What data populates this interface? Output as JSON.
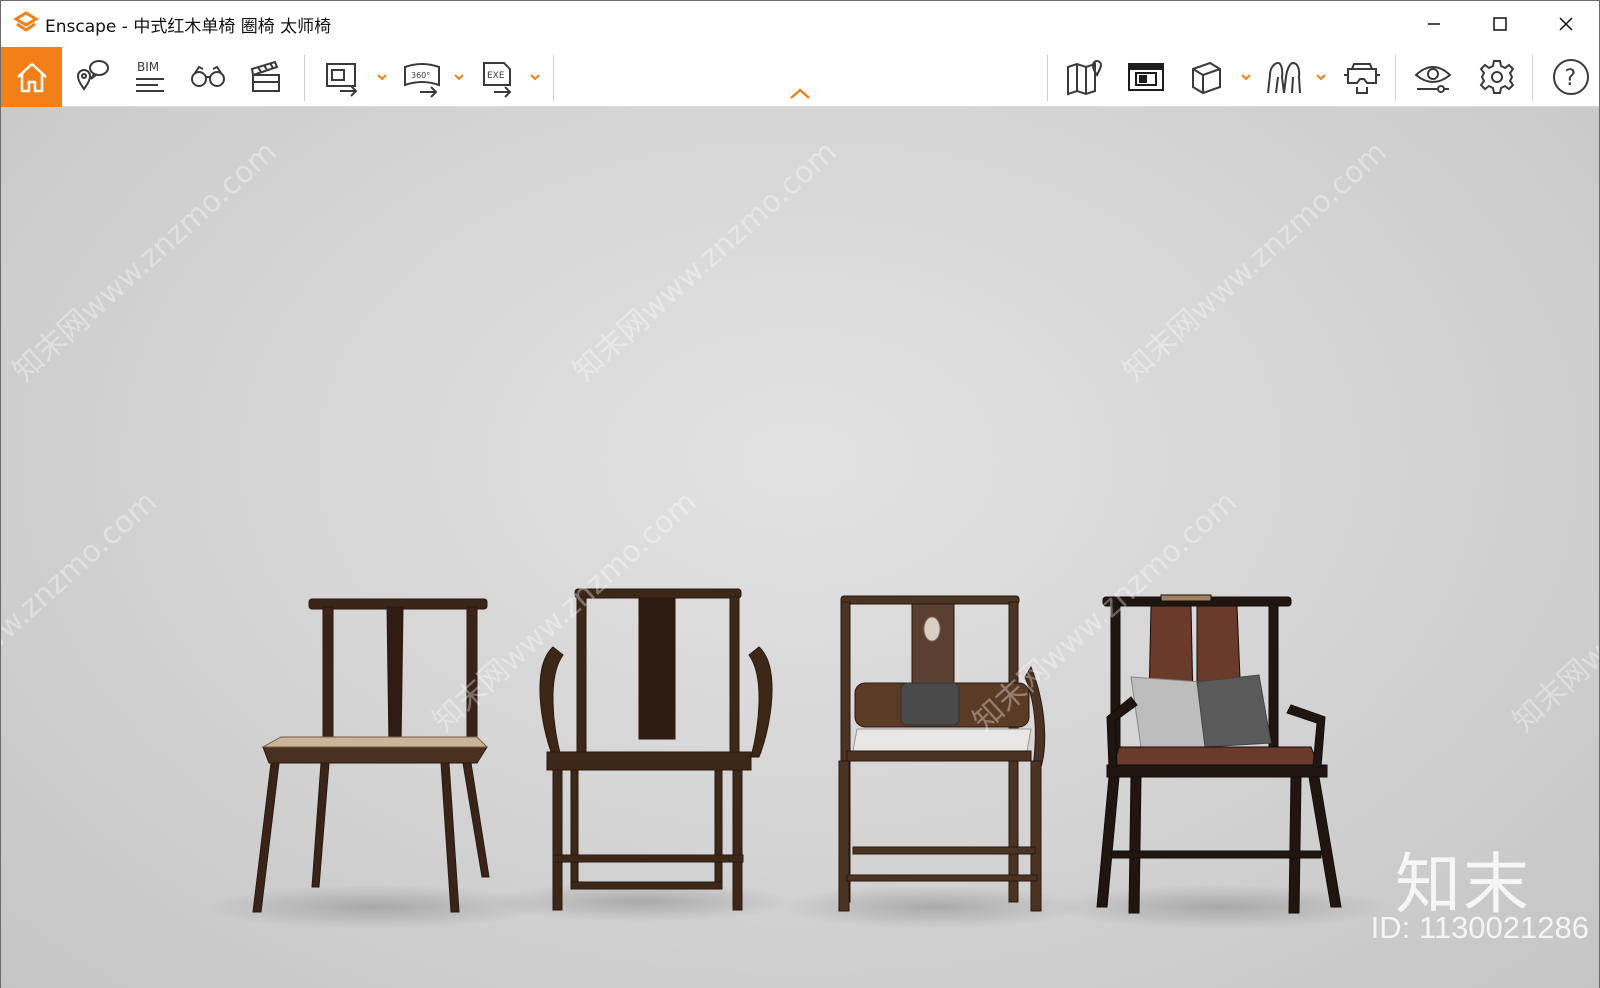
{
  "window": {
    "title_app": "Enscape",
    "title_separator": " - ",
    "title_doc": "中式红木单椅 圈椅 太师椅"
  },
  "toolbar": {
    "left_buttons": [
      "home-icon",
      "location-pin-icon",
      "bim-icon",
      "binoculars-icon",
      "clapperboard-icon"
    ],
    "export_buttons": [
      "render-export-icon",
      "panorama-360-export-icon",
      "exe-export-icon"
    ],
    "right_buttons": [
      "map-icon",
      "view-management-icon",
      "cube-icon",
      "asset-library-icon",
      "vr-headset-icon",
      "visual-settings-icon",
      "settings-gear-icon",
      "help-icon"
    ],
    "bim_label": "BIM",
    "label_360": "360°",
    "label_exe": "EXE",
    "help_label": "?"
  },
  "colors": {
    "accent": "#f57f17",
    "toolbar_icon": "#3a3a3a"
  },
  "viewport": {
    "watermark_text": "知末网www.znzmo.com",
    "brand": "知末",
    "id_label": "ID: 1130021286"
  }
}
